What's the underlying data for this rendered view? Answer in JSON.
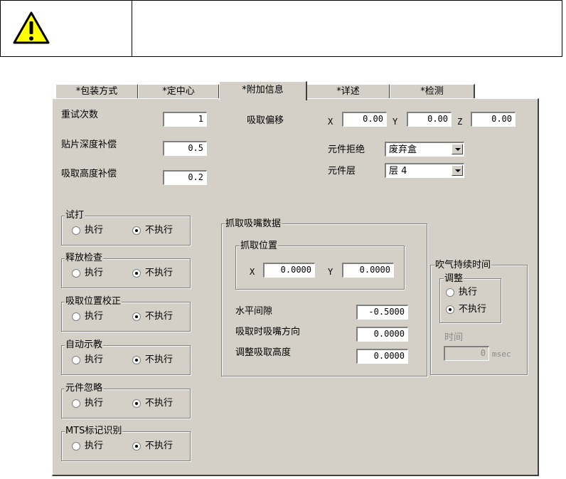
{
  "warning": {
    "icon": "warning-triangle-icon",
    "text": ""
  },
  "tabs": [
    "*包装方式",
    "*定中心",
    "*附加信息",
    "*详述",
    "*检测"
  ],
  "active_tab": "*附加信息",
  "fields": {
    "retry_label": "重试次数",
    "retry_value": "1",
    "depth_label": "贴片深度补偿",
    "depth_value": "0.5",
    "height_label": "吸取高度补偿",
    "height_value": "0.2"
  },
  "pick_offset": {
    "label": "吸取偏移",
    "x_label": "X",
    "x_value": "0.00",
    "y_label": "Y",
    "y_value": "0.00",
    "z_label": "Z",
    "z_value": "0.00"
  },
  "reject": {
    "label": "元件拒绝",
    "value": "废弃盒"
  },
  "layer": {
    "label": "元件层",
    "value": "层 4"
  },
  "radio_groups": [
    {
      "title": "试打",
      "opt1": "执行",
      "opt2": "不执行",
      "selected": "不执行"
    },
    {
      "title": "释放检查",
      "opt1": "执行",
      "opt2": "不执行",
      "selected": "不执行"
    },
    {
      "title": "吸取位置校正",
      "opt1": "执行",
      "opt2": "不执行",
      "selected": "不执行"
    },
    {
      "title": "自动示教",
      "opt1": "执行",
      "opt2": "不执行",
      "selected": "不执行"
    },
    {
      "title": "元件忽略",
      "opt1": "执行",
      "opt2": "不执行",
      "selected": "不执行"
    },
    {
      "title": "MTS标记识别",
      "opt1": "执行",
      "opt2": "不执行",
      "selected": "不执行"
    }
  ],
  "nozzle_data": {
    "title": "抓取吸嘴数据",
    "pick_pos_title": "抓取位置",
    "x_label": "X",
    "x_value": "0.0000",
    "y_label": "Y",
    "y_value": "0.0000",
    "h_gap_label": "水平间隙",
    "h_gap_value": "-0.5000",
    "dir_label": "吸取时吸嘴方向",
    "dir_value": "0.0000",
    "adj_label": "调整吸取高度",
    "adj_value": "0.0000"
  },
  "blow": {
    "title": "吹气持续时间",
    "adjust_title": "调整",
    "opt1": "执行",
    "opt2": "不执行",
    "selected": "不执行",
    "time_label": "时间",
    "time_value": "0",
    "time_unit": "msec"
  }
}
